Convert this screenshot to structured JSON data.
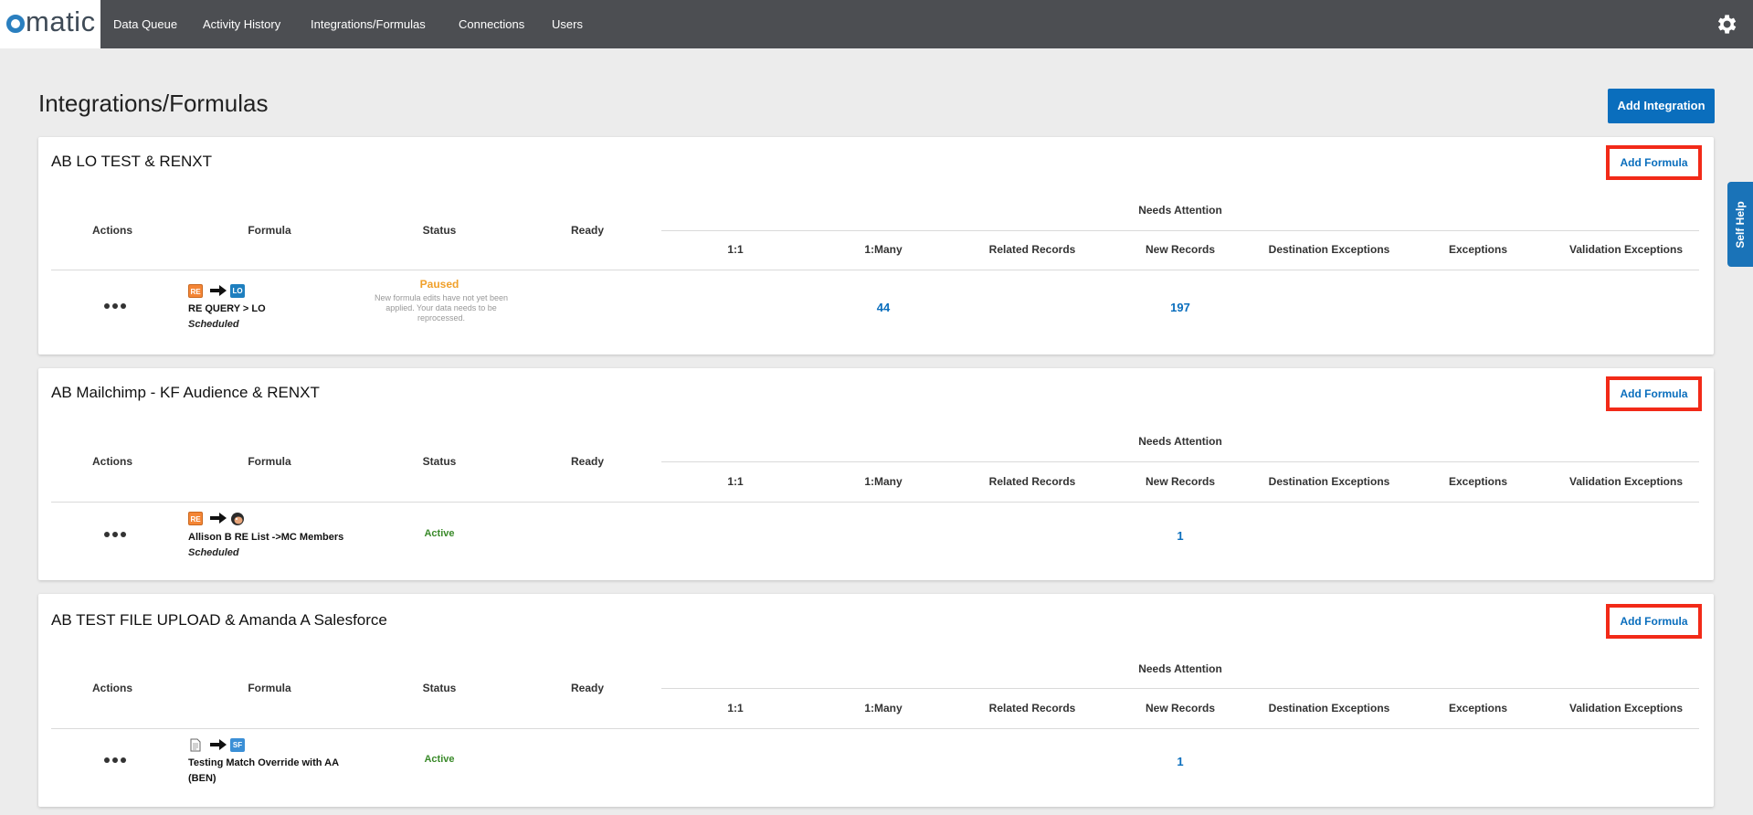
{
  "app": {
    "logo_text": "matic",
    "nav": [
      "Data Queue",
      "Activity History",
      "Integrations/Formulas",
      "Connections",
      "Users"
    ]
  },
  "page": {
    "title": "Integrations/Formulas",
    "add_integration_label": "Add Integration",
    "self_help_label": "Self Help"
  },
  "table_headers": {
    "actions": "Actions",
    "formula": "Formula",
    "status": "Status",
    "ready": "Ready",
    "needs_attention": "Needs Attention",
    "one_to_one": "1:1",
    "one_to_many": "1:Many",
    "related_records": "Related Records",
    "new_records": "New Records",
    "destination_exceptions": "Destination Exceptions",
    "exceptions": "Exceptions",
    "validation_exceptions": "Validation Exceptions"
  },
  "integrations": [
    {
      "title": "AB LO TEST & RENXT",
      "add_formula_label": "Add Formula",
      "formula": {
        "source_icon": "re-icon",
        "source_text": "RE",
        "dest_icon": "lo-icon",
        "dest_text": "LO",
        "name": "RE QUERY > LO",
        "schedule": "Scheduled",
        "status": "Paused",
        "status_note": "New formula edits have not yet been applied. Your data needs to be reprocessed.",
        "one_to_many": "44",
        "new_records": "197"
      }
    },
    {
      "title": "AB Mailchimp - KF Audience & RENXT",
      "add_formula_label": "Add Formula",
      "formula": {
        "source_icon": "re-icon",
        "source_text": "RE",
        "dest_icon": "mailchimp-icon",
        "name": "Allison B RE List ->MC Members",
        "schedule": "Scheduled",
        "status": "Active",
        "new_records": "1"
      }
    },
    {
      "title": "AB TEST FILE UPLOAD & Amanda A Salesforce",
      "add_formula_label": "Add Formula",
      "formula": {
        "source_icon": "file-icon",
        "dest_icon": "sf-icon",
        "dest_text": "SF",
        "name_line1": "Testing Match Override with AA",
        "name_line2": "(BEN)",
        "status": "Active",
        "new_records": "1"
      }
    }
  ],
  "colors": {
    "nav_bg": "#4c4e52",
    "primary": "#0a6ebd",
    "highlight_border": "#f22a18",
    "paused": "#f0a02a",
    "active": "#3a8a2a"
  }
}
